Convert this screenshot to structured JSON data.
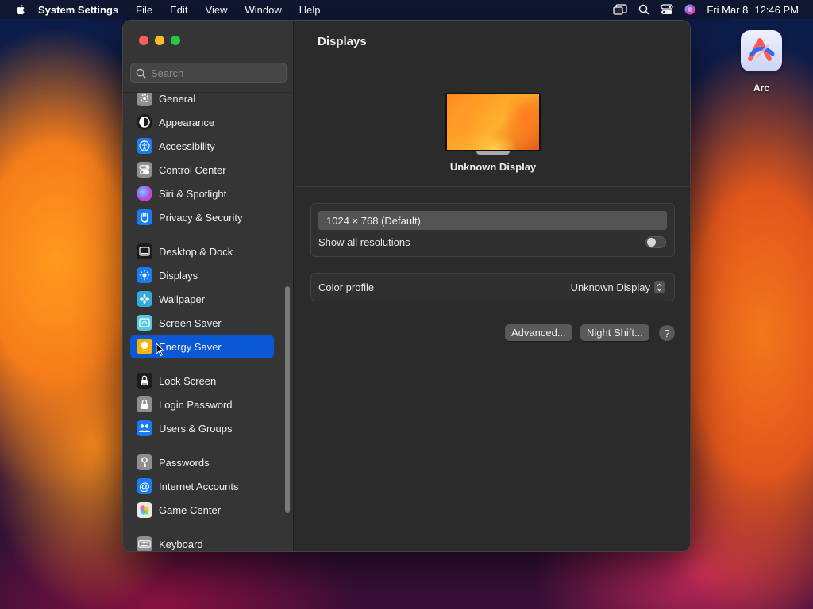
{
  "menubar": {
    "app_name": "System Settings",
    "items": [
      "File",
      "Edit",
      "View",
      "Window",
      "Help"
    ],
    "date": "Fri Mar 8",
    "time": "12:46 PM"
  },
  "desktop": {
    "icon_label": "Arc"
  },
  "window": {
    "search_placeholder": "Search",
    "sidebar": {
      "items": [
        {
          "label": "General",
          "icon": "gear-icon",
          "color": "#8e8e93"
        },
        {
          "label": "Appearance",
          "icon": "appearance-icon",
          "color": "#1c1c1e"
        },
        {
          "label": "Accessibility",
          "icon": "accessibility-icon",
          "color": "#1a7cf5"
        },
        {
          "label": "Control Center",
          "icon": "control-center-icon",
          "color": "#8e8e93"
        },
        {
          "label": "Siri & Spotlight",
          "icon": "siri-icon",
          "color": "#b33ad6"
        },
        {
          "label": "Privacy & Security",
          "icon": "hand-icon",
          "color": "#1a7cf5"
        },
        {
          "label": "Desktop & Dock",
          "icon": "dock-icon",
          "color": "#1c1c1e"
        },
        {
          "label": "Displays",
          "icon": "sun-icon",
          "color": "#1a7cf5"
        },
        {
          "label": "Wallpaper",
          "icon": "wallpaper-icon",
          "color": "#35aadc"
        },
        {
          "label": "Screen Saver",
          "icon": "screen-saver-icon",
          "color": "#5ac8e0"
        },
        {
          "label": "Energy Saver",
          "icon": "lightbulb-icon",
          "color": "#f5b400"
        },
        {
          "label": "Lock Screen",
          "icon": "lock-icon",
          "color": "#1c1c1e"
        },
        {
          "label": "Login Password",
          "icon": "padlock-icon",
          "color": "#8e8e93"
        },
        {
          "label": "Users & Groups",
          "icon": "users-icon",
          "color": "#1a7cf5"
        },
        {
          "label": "Passwords",
          "icon": "key-icon",
          "color": "#8e8e93"
        },
        {
          "label": "Internet Accounts",
          "icon": "at-icon",
          "color": "#1a7cf5"
        },
        {
          "label": "Game Center",
          "icon": "game-center-icon",
          "color": "#e8e8e8"
        },
        {
          "label": "Keyboard",
          "icon": "keyboard-icon",
          "color": "#8e8e93"
        }
      ],
      "selected": "Energy Saver"
    }
  },
  "content": {
    "title": "Displays",
    "display_name": "Unknown Display",
    "resolution": "1024 × 768 (Default)",
    "show_all_label": "Show all resolutions",
    "show_all_on": false,
    "color_profile_label": "Color profile",
    "color_profile_value": "Unknown Display",
    "advanced_button": "Advanced...",
    "night_shift_button": "Night Shift...",
    "help_button": "?"
  }
}
